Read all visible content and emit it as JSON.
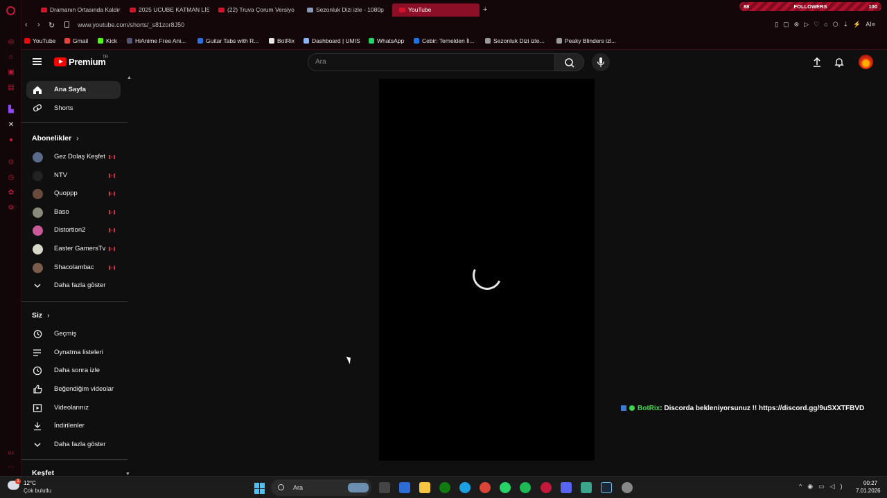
{
  "browser": {
    "tabs": [
      {
        "label": "Dramanın Ortasında Kaldır"
      },
      {
        "label": "2025 UCUBE KATMAN LİS"
      },
      {
        "label": "(22) Truva Çorum Versiyo"
      },
      {
        "label": "Sezonluk Dizi izle - 1080p"
      },
      {
        "label": "YouTube"
      }
    ],
    "new_tab": "+",
    "followers_widget": {
      "left": "88",
      "label": "FOLLOWERS",
      "right": "100"
    },
    "url": "www.youtube.com/shorts/_s81zor8J50",
    "ai_label": "AI",
    "bookmarks": [
      {
        "label": "YouTube",
        "color": "#ff0000"
      },
      {
        "label": "Gmail",
        "color": "#ea4335"
      },
      {
        "label": "Kick",
        "color": "#53fc18"
      },
      {
        "label": "HiAnime Free Ani...",
        "color": "#555577"
      },
      {
        "label": "Guitar Tabs with R...",
        "color": "#2a6fdb"
      },
      {
        "label": "BotRix",
        "color": "#e6e6e6"
      },
      {
        "label": "Dashboard | UMIS",
        "color": "#8ab4f8"
      },
      {
        "label": "WhatsApp",
        "color": "#25d366"
      },
      {
        "label": "Cebir: Temelden İl...",
        "color": "#1a73e8"
      },
      {
        "label": "Sezonluk Dizi izle...",
        "color": "#9a9a9a"
      },
      {
        "label": "Peaky Blinders izl...",
        "color": "#9a9a9a"
      }
    ]
  },
  "youtube": {
    "logo_text": "Premium",
    "logo_region": "TR",
    "search_placeholder": "Ara",
    "sidebar": {
      "main": [
        {
          "label": "Ana Sayfa",
          "icon": "home-icon"
        },
        {
          "label": "Shorts",
          "icon": "shorts-icon"
        }
      ],
      "subscriptions_title": "Abonelikler",
      "subscriptions": [
        {
          "label": "Gez Dolaş Keşfet",
          "color": "#5a6a8a"
        },
        {
          "label": "NTV",
          "color": "#222222"
        },
        {
          "label": "Quoppp",
          "color": "#6a4a3a"
        },
        {
          "label": "Baso",
          "color": "#8a8a7a"
        },
        {
          "label": "Distortion2",
          "color": "#c85a9a"
        },
        {
          "label": "Easter GamersTv",
          "color": "#d8d8c8"
        },
        {
          "label": "Shacolambac",
          "color": "#7a5a4a"
        }
      ],
      "show_more": "Daha fazla göster",
      "you_title": "Siz",
      "you_items": [
        {
          "label": "Geçmiş",
          "icon": "history-icon"
        },
        {
          "label": "Oynatma listeleri",
          "icon": "playlist-icon"
        },
        {
          "label": "Daha sonra izle",
          "icon": "clock-icon"
        },
        {
          "label": "Beğendiğim videolar",
          "icon": "thumbs-up-icon"
        },
        {
          "label": "Videolarınız",
          "icon": "video-icon"
        },
        {
          "label": "İndirilenler",
          "icon": "download-icon"
        }
      ],
      "show_more_2": "Daha fazla göster",
      "explore_title": "Keşfet"
    },
    "overlay": {
      "bot": "BotRix",
      "message": ": Discorda bekleniyorsunuz !! https://discord.gg/9uSXXTFBVD"
    }
  },
  "taskbar": {
    "weather_badge": "1",
    "temperature": "12°C",
    "weather": "Çok bulutlu",
    "search": "Ara",
    "time": "00:27",
    "date": "7.01.2026",
    "apps": [
      {
        "name": "file-explorer-icon",
        "color": "#f5c443"
      },
      {
        "name": "xbox-icon",
        "color": "#107c10"
      },
      {
        "name": "edge-icon",
        "color": "#1ba1e2"
      },
      {
        "name": "chrome-icon",
        "color": "#db4437"
      },
      {
        "name": "whatsapp-icon",
        "color": "#25d366"
      },
      {
        "name": "spotify-icon",
        "color": "#1db954"
      },
      {
        "name": "opera-gx-icon",
        "color": "#c2183c"
      },
      {
        "name": "discord-icon",
        "color": "#5865f2"
      },
      {
        "name": "notepad-icon",
        "color": "#3aa58a"
      },
      {
        "name": "steam-icon",
        "color": "#1b2838"
      },
      {
        "name": "settings-icon",
        "color": "#888888"
      }
    ]
  }
}
